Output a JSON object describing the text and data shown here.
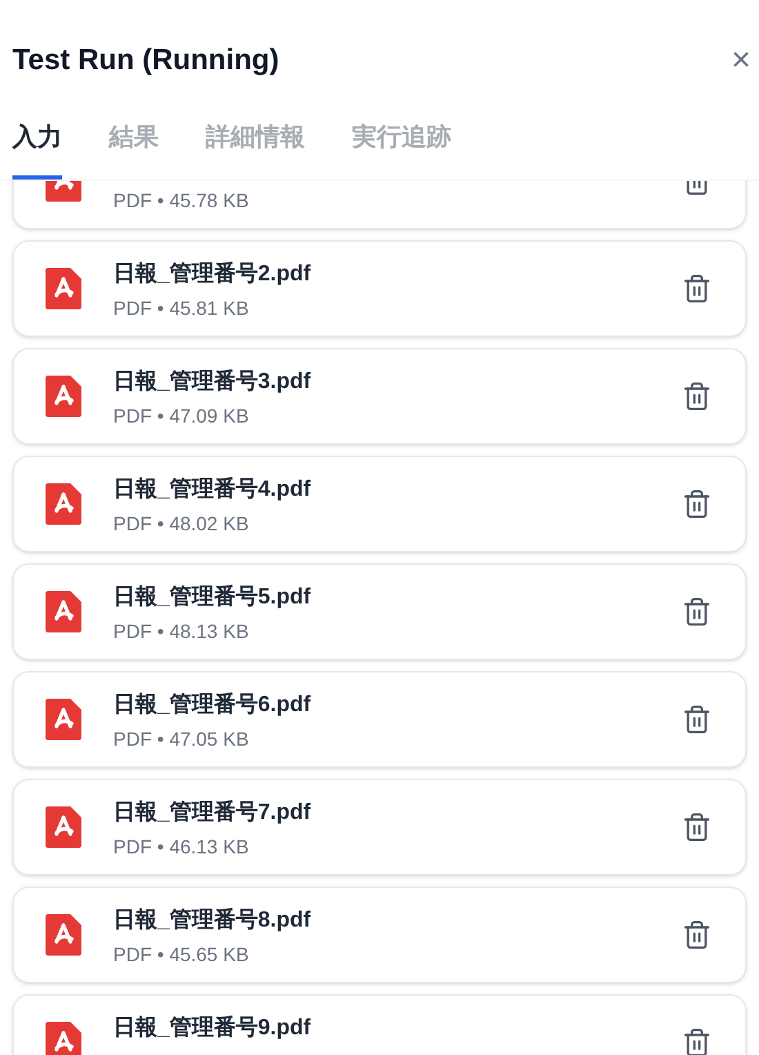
{
  "title": "Test Run (Running)",
  "close": "×",
  "separator": "•",
  "tabs": [
    {
      "label": "入力",
      "selected": true
    },
    {
      "label": "結果",
      "selected": false
    },
    {
      "label": "詳細情報",
      "selected": false
    },
    {
      "label": "実行追跡",
      "selected": false
    }
  ],
  "files": [
    {
      "type": "PDF",
      "size": "45.78 KB"
    },
    {
      "name": "日報_管理番号2.pdf",
      "type": "PDF",
      "size": "45.81 KB"
    },
    {
      "name": "日報_管理番号3.pdf",
      "type": "PDF",
      "size": "47.09 KB"
    },
    {
      "name": "日報_管理番号4.pdf",
      "type": "PDF",
      "size": "48.02 KB"
    },
    {
      "name": "日報_管理番号5.pdf",
      "type": "PDF",
      "size": "48.13 KB"
    },
    {
      "name": "日報_管理番号6.pdf",
      "type": "PDF",
      "size": "47.05 KB"
    },
    {
      "name": "日報_管理番号7.pdf",
      "type": "PDF",
      "size": "46.13 KB"
    },
    {
      "name": "日報_管理番号8.pdf",
      "type": "PDF",
      "size": "45.65 KB"
    },
    {
      "name": "日報_管理番号9.pdf"
    }
  ]
}
